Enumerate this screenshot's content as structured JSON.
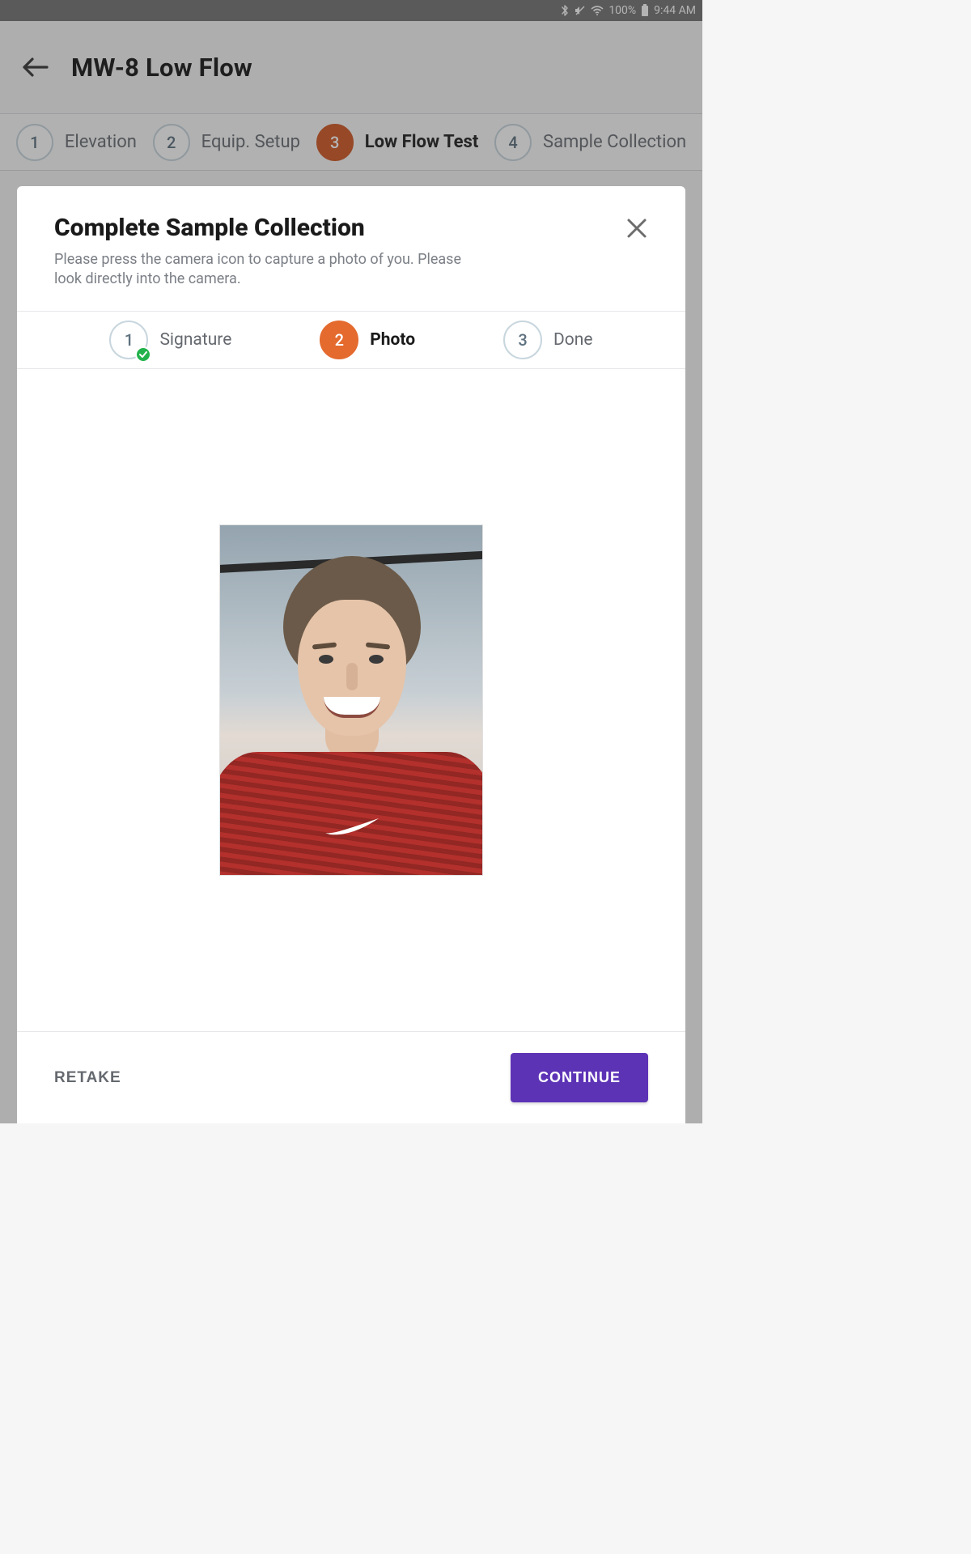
{
  "statusbar": {
    "battery": "100%",
    "time": "9:44 AM"
  },
  "header": {
    "title": "MW-8 Low Flow"
  },
  "main_steps": [
    {
      "num": "1",
      "label": "Elevation"
    },
    {
      "num": "2",
      "label": "Equip. Setup"
    },
    {
      "num": "3",
      "label": "Low Flow Test"
    },
    {
      "num": "4",
      "label": "Sample Collection"
    }
  ],
  "dialog": {
    "title": "Complete Sample Collection",
    "subtitle": "Please press the camera icon to capture a photo of you. Please look directly into the camera.",
    "steps": [
      {
        "num": "1",
        "label": "Signature"
      },
      {
        "num": "2",
        "label": "Photo"
      },
      {
        "num": "3",
        "label": "Done"
      }
    ],
    "retake": "RETAKE",
    "continue": "CONTINUE"
  }
}
